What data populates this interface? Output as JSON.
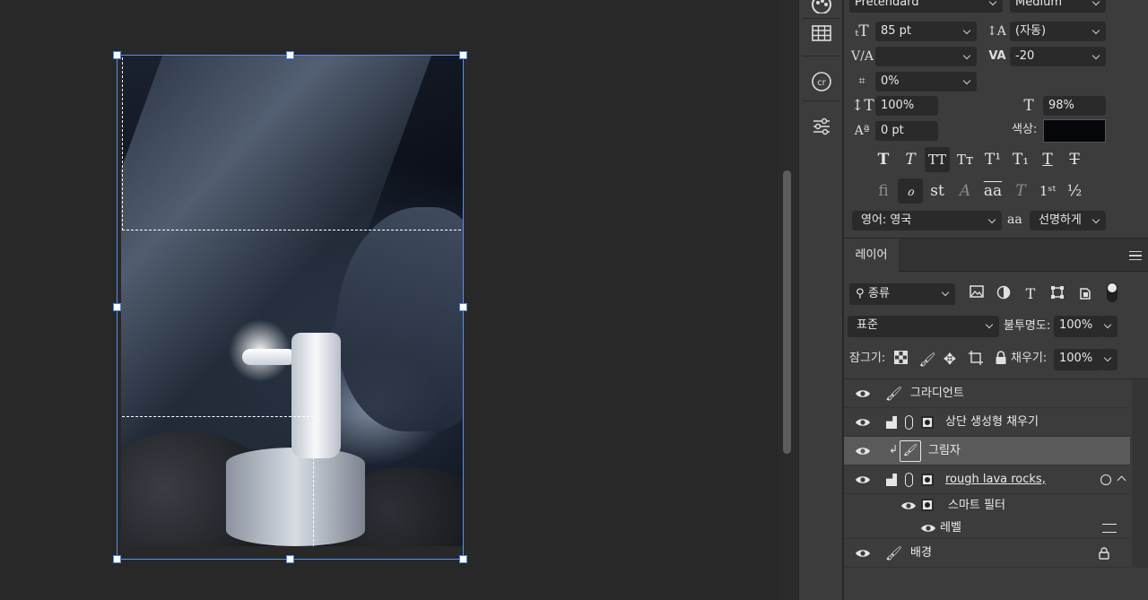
{
  "character_panel": {
    "font_family": "Pretendard",
    "font_style": "Medium",
    "font_size": "85 pt",
    "leading": "(자동)",
    "kerning": "",
    "tracking": "-20",
    "tsume": "0%",
    "vertical_scale": "100%",
    "horizontal_scale": "98%",
    "baseline_shift": "0 pt",
    "color_label": "색상:",
    "color": "#05070a",
    "language": "영어: 영국",
    "aa_icon": "aa",
    "antialias": "선명하게"
  },
  "layers_panel": {
    "tab": "레이어",
    "filter_kind": "종류",
    "blend_mode": "표준",
    "opacity_label": "불투명도:",
    "opacity": "100%",
    "lock_label": "잠그기:",
    "fill_label": "채우기:",
    "fill": "100%",
    "layers": [
      {
        "name": "그라디언트"
      },
      {
        "name": "상단 생성형 채우기"
      },
      {
        "name": "그림자"
      },
      {
        "name": "rough lava rocks,"
      },
      {
        "name": "스마트 필터"
      },
      {
        "name": "레벨"
      },
      {
        "name": "배경"
      }
    ]
  },
  "colors": {
    "accent": "#4a86e8",
    "panel_bg": "#3c3c3c",
    "canvas_bg": "#282828"
  }
}
